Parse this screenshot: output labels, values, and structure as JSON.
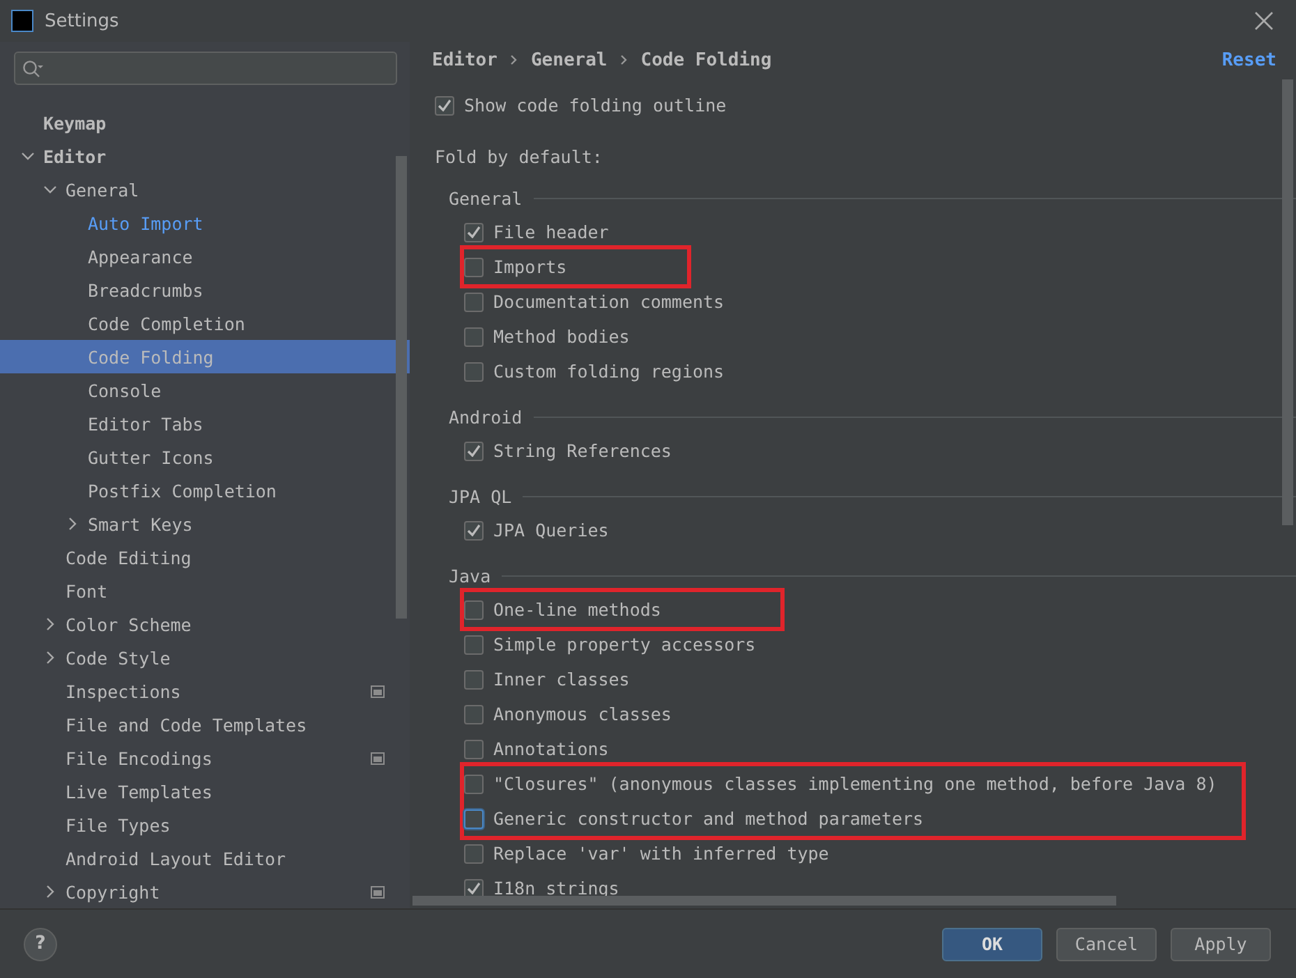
{
  "window": {
    "title": "Settings"
  },
  "sidebar": {
    "items": [
      {
        "label": "Keymap",
        "selected": false
      },
      {
        "label": "Editor",
        "selected": false,
        "expanded": true,
        "children": [
          {
            "label": "General",
            "selected": false,
            "expanded": true,
            "children": [
              {
                "label": "Auto Import",
                "selected": false,
                "modified": true
              },
              {
                "label": "Appearance",
                "selected": false
              },
              {
                "label": "Breadcrumbs",
                "selected": false
              },
              {
                "label": "Code Completion",
                "selected": false
              },
              {
                "label": "Code Folding",
                "selected": true
              },
              {
                "label": "Console",
                "selected": false
              },
              {
                "label": "Editor Tabs",
                "selected": false
              },
              {
                "label": "Gutter Icons",
                "selected": false
              },
              {
                "label": "Postfix Completion",
                "selected": false
              },
              {
                "label": "Smart Keys",
                "selected": false,
                "expanded": false
              }
            ]
          },
          {
            "label": "Code Editing",
            "selected": false
          },
          {
            "label": "Font",
            "selected": false
          },
          {
            "label": "Color Scheme",
            "selected": false,
            "expanded": false
          },
          {
            "label": "Code Style",
            "selected": false,
            "expanded": false
          },
          {
            "label": "Inspections",
            "selected": false,
            "project_scope": true
          },
          {
            "label": "File and Code Templates",
            "selected": false
          },
          {
            "label": "File Encodings",
            "selected": false,
            "project_scope": true
          },
          {
            "label": "Live Templates",
            "selected": false
          },
          {
            "label": "File Types",
            "selected": false
          },
          {
            "label": "Android Layout Editor",
            "selected": false
          },
          {
            "label": "Copyright",
            "selected": false,
            "expanded": false,
            "project_scope": true
          }
        ]
      }
    ]
  },
  "breadcrumb": [
    "Editor",
    "General",
    "Code Folding"
  ],
  "reset_link": "Reset",
  "show_outline": {
    "label": "Show code folding outline",
    "checked": true
  },
  "fold_label": "Fold by default:",
  "sections": [
    {
      "title": "General",
      "items": [
        {
          "label": "File header",
          "checked": true,
          "highlighted": false
        },
        {
          "label": "Imports",
          "checked": false,
          "highlighted": true
        },
        {
          "label": "Documentation comments",
          "checked": false,
          "highlighted": false
        },
        {
          "label": "Method bodies",
          "checked": false,
          "highlighted": false
        },
        {
          "label": "Custom folding regions",
          "checked": false,
          "highlighted": false
        }
      ]
    },
    {
      "title": "Android",
      "items": [
        {
          "label": "String References",
          "checked": true,
          "highlighted": false
        }
      ]
    },
    {
      "title": "JPA QL",
      "items": [
        {
          "label": "JPA Queries",
          "checked": true,
          "highlighted": false
        }
      ]
    },
    {
      "title": "Java",
      "items": [
        {
          "label": "One-line methods",
          "checked": false,
          "highlighted": true
        },
        {
          "label": "Simple property accessors",
          "checked": false,
          "highlighted": false
        },
        {
          "label": "Inner classes",
          "checked": false,
          "highlighted": false
        },
        {
          "label": "Anonymous classes",
          "checked": false,
          "highlighted": false
        },
        {
          "label": "Annotations",
          "checked": false,
          "highlighted": false
        },
        {
          "label": "\"Closures\" (anonymous classes implementing one method, before Java 8)",
          "checked": false,
          "highlighted": true
        },
        {
          "label": "Generic constructor and method parameters",
          "checked": false,
          "highlighted": true,
          "focused": true
        },
        {
          "label": "Replace 'var' with inferred type",
          "checked": false,
          "highlighted": false
        },
        {
          "label": "I18n strings",
          "checked": true,
          "highlighted": false
        }
      ]
    }
  ],
  "help_button": "?",
  "buttons": [
    {
      "label": "OK",
      "primary": true
    },
    {
      "label": "Cancel",
      "primary": false
    },
    {
      "label": "Apply",
      "primary": false
    }
  ]
}
